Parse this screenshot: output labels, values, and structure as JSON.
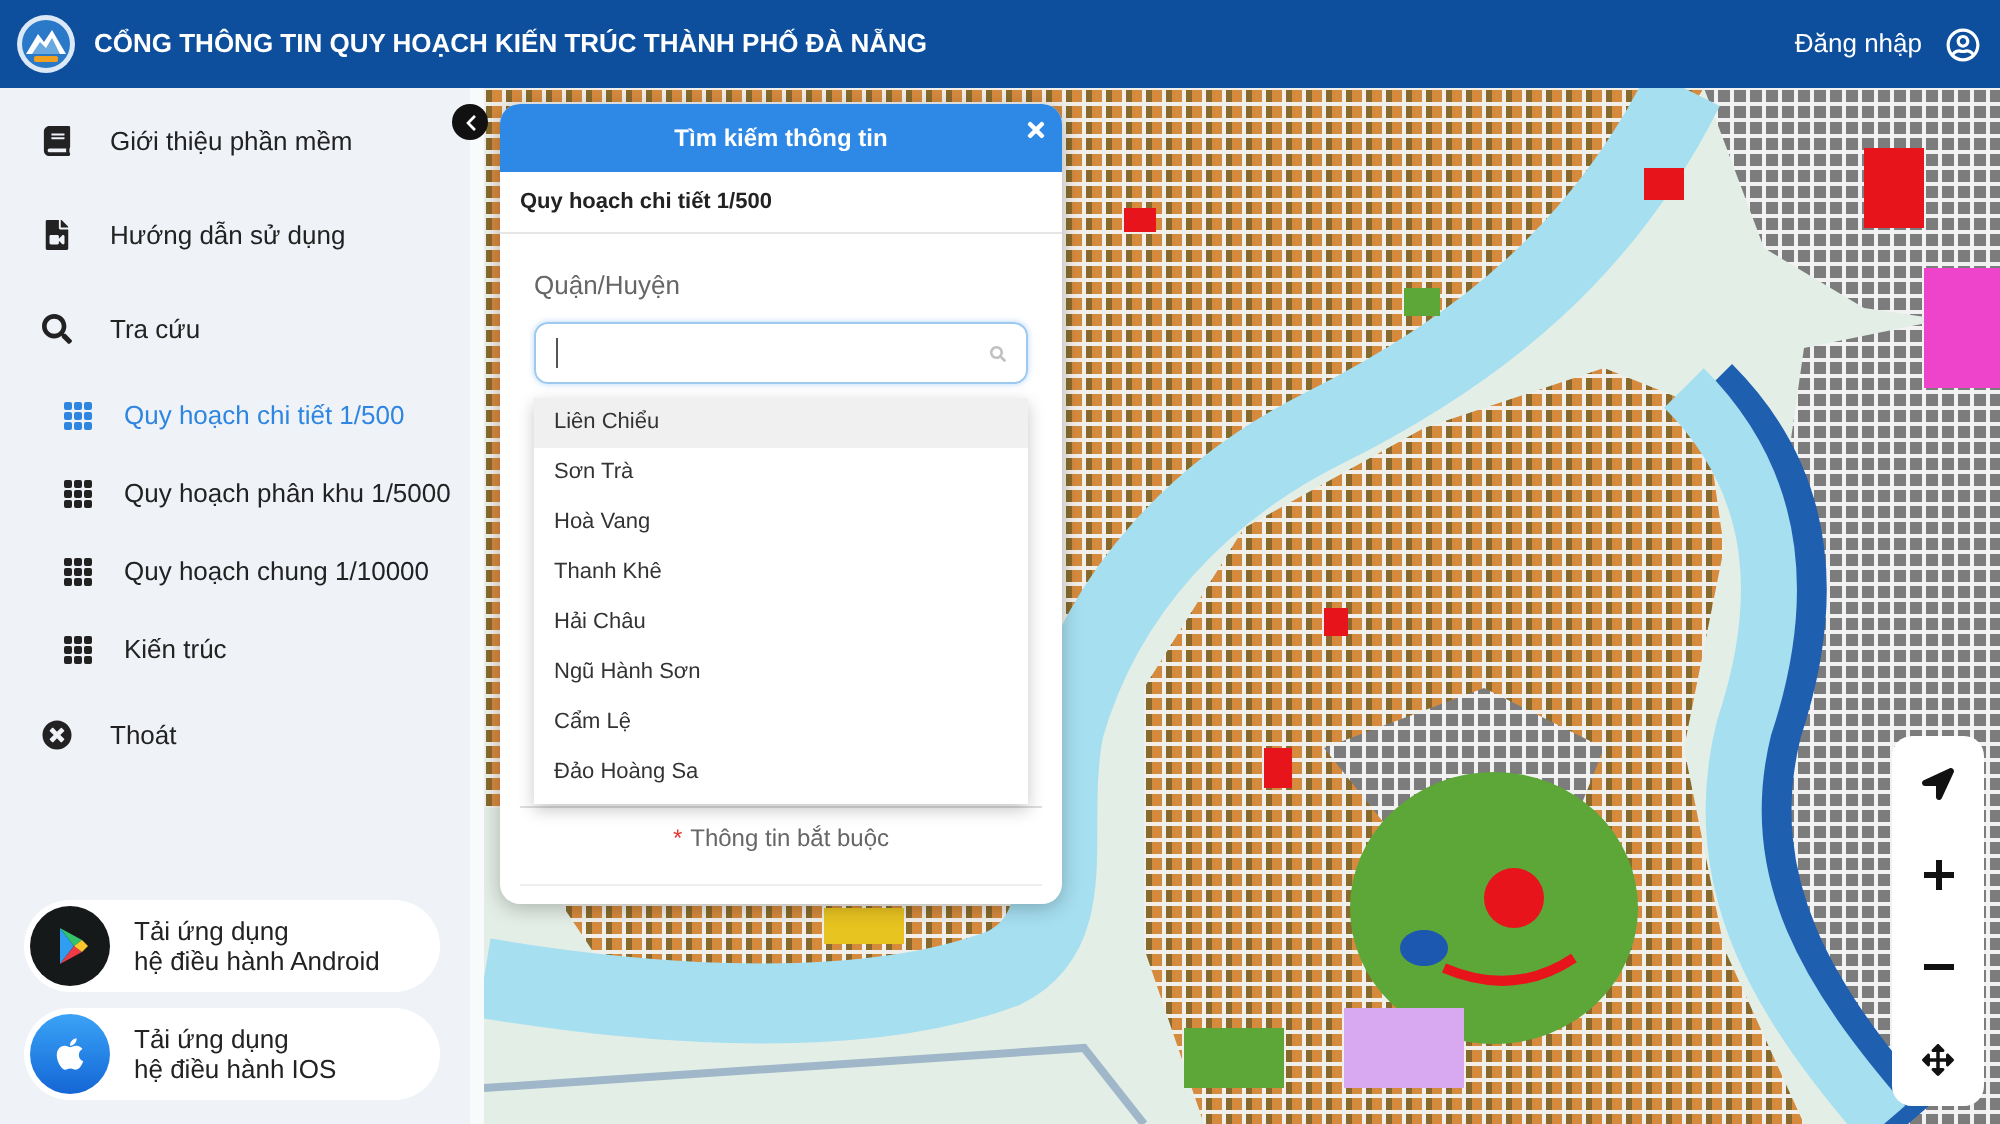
{
  "header": {
    "title": "CỔNG THÔNG TIN QUY HOẠCH KIẾN TRÚC THÀNH PHỐ ĐÀ NẴNG",
    "login": "Đăng nhập"
  },
  "sidebar": {
    "menu": [
      {
        "label": "Giới thiệu phần mềm",
        "selected": false
      },
      {
        "label": "Hướng dẫn sử dụng",
        "selected": false
      },
      {
        "label": "Tra cứu",
        "selected": false,
        "children": [
          {
            "label": "Quy hoạch chi tiết 1/500",
            "selected": true
          },
          {
            "label": "Quy hoạch phân khu 1/5000",
            "selected": false
          },
          {
            "label": "Quy hoạch chung 1/10000",
            "selected": false
          },
          {
            "label": "Kiến trúc",
            "selected": false
          }
        ]
      },
      {
        "label": "Thoát",
        "selected": false
      }
    ],
    "app_downloads": [
      {
        "kind": "android",
        "lines": [
          "Tải ứng dụng",
          "hệ điều hành Android"
        ]
      },
      {
        "kind": "ios",
        "lines": [
          "Tải ứng dụng",
          "hệ điều hành IOS"
        ]
      }
    ]
  },
  "search_panel": {
    "title": "Tìm kiếm thông tin",
    "subtitle": "Quy hoạch chi tiết 1/500",
    "field": {
      "label": "Quận/Huyện",
      "focused": true
    },
    "options": [
      {
        "label": "Liên Chiểu",
        "highlighted": true
      },
      {
        "label": "Sơn Trà",
        "highlighted": false
      },
      {
        "label": "Hoà Vang",
        "highlighted": false
      },
      {
        "label": "Thanh Khê",
        "highlighted": false
      },
      {
        "label": "Hải Châu",
        "highlighted": false
      },
      {
        "label": "Ngũ Hành Sơn",
        "highlighted": false
      },
      {
        "label": "Cẩm Lệ",
        "highlighted": false
      },
      {
        "label": "Đảo Hoàng Sa",
        "highlighted": false
      }
    ],
    "required_note": {
      "mark": "*",
      "text": "Thông tin bắt buộc"
    }
  }
}
